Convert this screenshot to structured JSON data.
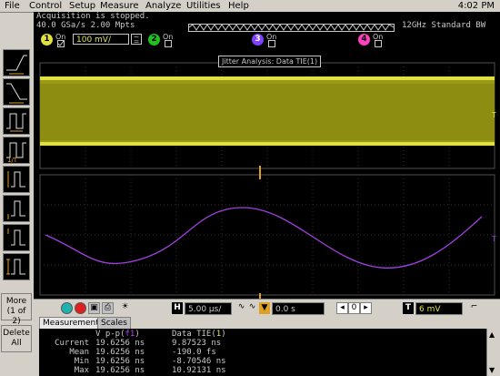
{
  "menu": {
    "items": [
      "File",
      "Control",
      "Setup",
      "Measure",
      "Analyze",
      "Utilities",
      "Help"
    ],
    "clock": "4:02 PM"
  },
  "status": {
    "line1": "Acquisition is stopped.",
    "line2": "40.0 GSa/s  2.00 Mpts",
    "bandwidth": "12GHz Standard BW"
  },
  "channels": [
    {
      "num": "1",
      "on_label": "On",
      "scale": "100 mV/",
      "color": "#e0e040"
    },
    {
      "num": "2",
      "on_label": "On",
      "color": "#20c020"
    },
    {
      "num": "3",
      "on_label": "On",
      "color": "#8040ff"
    },
    {
      "num": "4",
      "on_label": "On",
      "color": "#ff40c0"
    }
  ],
  "left_toolbar": {
    "more_label": "More",
    "more_sub": "(1 of 2)",
    "delete_label": "Delete",
    "delete_sub": "All"
  },
  "screen": {
    "function_label": "Jitter Analysis: Data TIE(1)",
    "upper_marker": "T",
    "lower_marker": "T"
  },
  "controls": {
    "h_label": "H",
    "time_per_div": "5.00 µs/",
    "delay": "0.0 s",
    "trigger_label": "T",
    "trigger_level": "6 mV"
  },
  "measurements": {
    "tabs": [
      "Measurements",
      "Scales"
    ],
    "header": {
      "c1": "V p-p(",
      "c1_ch": "f1",
      "c1_end": ")",
      "c2": "Data TIE(",
      "c2_ch": "1",
      "c2_end": ")"
    },
    "rows": [
      {
        "label": "Current",
        "v1": "19.6256 ns",
        "v2": "9.87523 ns"
      },
      {
        "label": "Mean",
        "v1": "19.6256 ns",
        "v2": "-190.0 fs"
      },
      {
        "label": "Min",
        "v1": "19.6256 ns",
        "v2": "-8.70546 ns"
      },
      {
        "label": "Max",
        "v1": "19.6256 ns",
        "v2": "10.92131 ns"
      }
    ]
  },
  "colors": {
    "ch1": "#e0e040",
    "math": "#a040e0",
    "background": "#000000",
    "grid": "#404040"
  }
}
